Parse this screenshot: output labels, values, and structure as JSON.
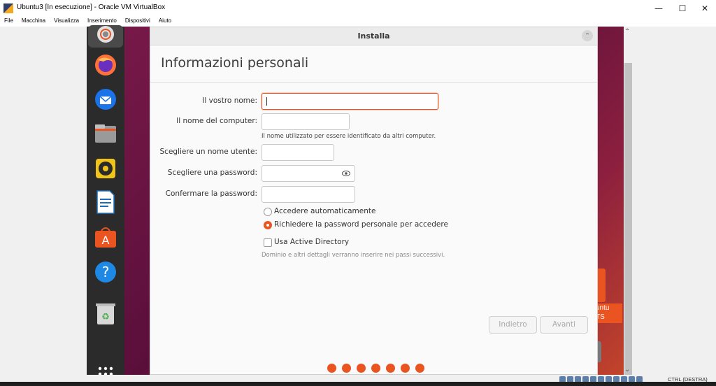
{
  "window": {
    "title": "Ubuntu3 [In esecuzione] - Oracle VM VirtualBox",
    "min_glyph": "—",
    "max_glyph": "☐",
    "close_glyph": "✕"
  },
  "menu": {
    "items": [
      "File",
      "Macchina",
      "Visualizza",
      "Inserimento",
      "Dispositivi",
      "Aiuto"
    ]
  },
  "dock": {
    "items": [
      {
        "name": "installer-disk-icon"
      },
      {
        "name": "firefox-icon"
      },
      {
        "name": "thunderbird-icon"
      },
      {
        "name": "files-icon"
      },
      {
        "name": "rhythmbox-icon"
      },
      {
        "name": "libreoffice-writer-icon"
      },
      {
        "name": "software-center-icon"
      },
      {
        "name": "help-icon"
      },
      {
        "name": "trash-icon"
      },
      {
        "name": "app-grid-icon"
      }
    ]
  },
  "desktop": {
    "icon_label_line1": "untu",
    "icon_label_line2": "TS"
  },
  "installer": {
    "window_title": "Installa",
    "minimize_glyph": "–",
    "page_title": "Informazioni personali",
    "fields": {
      "name_label": "Il vostro nome:",
      "name_value": "",
      "computer_label": "Il nome del computer:",
      "computer_value": "",
      "computer_hint": "Il nome utilizzato per essere identificato da altri computer.",
      "username_label": "Scegliere un nome utente:",
      "username_value": "",
      "password_label": "Scegliere una password:",
      "password_value": "",
      "confirm_label": "Confermare la password:",
      "confirm_value": ""
    },
    "options": {
      "auto_login_label": "Accedere automaticamente",
      "require_password_label": "Richiedere la password personale per accedere",
      "selected": "require_password",
      "active_directory_label": "Usa Active Directory",
      "active_directory_checked": false,
      "active_directory_hint": "Dominio e altri dettagli verranno inserire nei passi successivi."
    },
    "buttons": {
      "back_label": "Indietro",
      "forward_label": "Avanti"
    },
    "progress_dots": 7,
    "accent_color": "#e95420"
  },
  "statusbar": {
    "host_key_label": "CTRL (DESTRA)"
  }
}
